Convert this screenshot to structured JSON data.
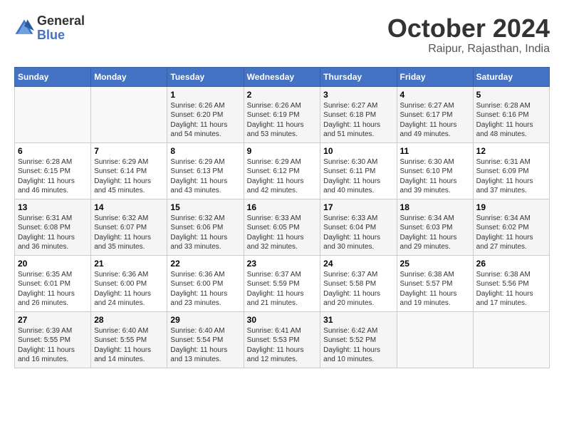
{
  "header": {
    "logo_general": "General",
    "logo_blue": "Blue",
    "month_title": "October 2024",
    "location": "Raipur, Rajasthan, India"
  },
  "columns": [
    "Sunday",
    "Monday",
    "Tuesday",
    "Wednesday",
    "Thursday",
    "Friday",
    "Saturday"
  ],
  "weeks": [
    [
      {
        "day": "",
        "info": ""
      },
      {
        "day": "",
        "info": ""
      },
      {
        "day": "1",
        "info": "Sunrise: 6:26 AM\nSunset: 6:20 PM\nDaylight: 11 hours and 54 minutes."
      },
      {
        "day": "2",
        "info": "Sunrise: 6:26 AM\nSunset: 6:19 PM\nDaylight: 11 hours and 53 minutes."
      },
      {
        "day": "3",
        "info": "Sunrise: 6:27 AM\nSunset: 6:18 PM\nDaylight: 11 hours and 51 minutes."
      },
      {
        "day": "4",
        "info": "Sunrise: 6:27 AM\nSunset: 6:17 PM\nDaylight: 11 hours and 49 minutes."
      },
      {
        "day": "5",
        "info": "Sunrise: 6:28 AM\nSunset: 6:16 PM\nDaylight: 11 hours and 48 minutes."
      }
    ],
    [
      {
        "day": "6",
        "info": "Sunrise: 6:28 AM\nSunset: 6:15 PM\nDaylight: 11 hours and 46 minutes."
      },
      {
        "day": "7",
        "info": "Sunrise: 6:29 AM\nSunset: 6:14 PM\nDaylight: 11 hours and 45 minutes."
      },
      {
        "day": "8",
        "info": "Sunrise: 6:29 AM\nSunset: 6:13 PM\nDaylight: 11 hours and 43 minutes."
      },
      {
        "day": "9",
        "info": "Sunrise: 6:29 AM\nSunset: 6:12 PM\nDaylight: 11 hours and 42 minutes."
      },
      {
        "day": "10",
        "info": "Sunrise: 6:30 AM\nSunset: 6:11 PM\nDaylight: 11 hours and 40 minutes."
      },
      {
        "day": "11",
        "info": "Sunrise: 6:30 AM\nSunset: 6:10 PM\nDaylight: 11 hours and 39 minutes."
      },
      {
        "day": "12",
        "info": "Sunrise: 6:31 AM\nSunset: 6:09 PM\nDaylight: 11 hours and 37 minutes."
      }
    ],
    [
      {
        "day": "13",
        "info": "Sunrise: 6:31 AM\nSunset: 6:08 PM\nDaylight: 11 hours and 36 minutes."
      },
      {
        "day": "14",
        "info": "Sunrise: 6:32 AM\nSunset: 6:07 PM\nDaylight: 11 hours and 35 minutes."
      },
      {
        "day": "15",
        "info": "Sunrise: 6:32 AM\nSunset: 6:06 PM\nDaylight: 11 hours and 33 minutes."
      },
      {
        "day": "16",
        "info": "Sunrise: 6:33 AM\nSunset: 6:05 PM\nDaylight: 11 hours and 32 minutes."
      },
      {
        "day": "17",
        "info": "Sunrise: 6:33 AM\nSunset: 6:04 PM\nDaylight: 11 hours and 30 minutes."
      },
      {
        "day": "18",
        "info": "Sunrise: 6:34 AM\nSunset: 6:03 PM\nDaylight: 11 hours and 29 minutes."
      },
      {
        "day": "19",
        "info": "Sunrise: 6:34 AM\nSunset: 6:02 PM\nDaylight: 11 hours and 27 minutes."
      }
    ],
    [
      {
        "day": "20",
        "info": "Sunrise: 6:35 AM\nSunset: 6:01 PM\nDaylight: 11 hours and 26 minutes."
      },
      {
        "day": "21",
        "info": "Sunrise: 6:36 AM\nSunset: 6:00 PM\nDaylight: 11 hours and 24 minutes."
      },
      {
        "day": "22",
        "info": "Sunrise: 6:36 AM\nSunset: 6:00 PM\nDaylight: 11 hours and 23 minutes."
      },
      {
        "day": "23",
        "info": "Sunrise: 6:37 AM\nSunset: 5:59 PM\nDaylight: 11 hours and 21 minutes."
      },
      {
        "day": "24",
        "info": "Sunrise: 6:37 AM\nSunset: 5:58 PM\nDaylight: 11 hours and 20 minutes."
      },
      {
        "day": "25",
        "info": "Sunrise: 6:38 AM\nSunset: 5:57 PM\nDaylight: 11 hours and 19 minutes."
      },
      {
        "day": "26",
        "info": "Sunrise: 6:38 AM\nSunset: 5:56 PM\nDaylight: 11 hours and 17 minutes."
      }
    ],
    [
      {
        "day": "27",
        "info": "Sunrise: 6:39 AM\nSunset: 5:55 PM\nDaylight: 11 hours and 16 minutes."
      },
      {
        "day": "28",
        "info": "Sunrise: 6:40 AM\nSunset: 5:55 PM\nDaylight: 11 hours and 14 minutes."
      },
      {
        "day": "29",
        "info": "Sunrise: 6:40 AM\nSunset: 5:54 PM\nDaylight: 11 hours and 13 minutes."
      },
      {
        "day": "30",
        "info": "Sunrise: 6:41 AM\nSunset: 5:53 PM\nDaylight: 11 hours and 12 minutes."
      },
      {
        "day": "31",
        "info": "Sunrise: 6:42 AM\nSunset: 5:52 PM\nDaylight: 11 hours and 10 minutes."
      },
      {
        "day": "",
        "info": ""
      },
      {
        "day": "",
        "info": ""
      }
    ]
  ]
}
